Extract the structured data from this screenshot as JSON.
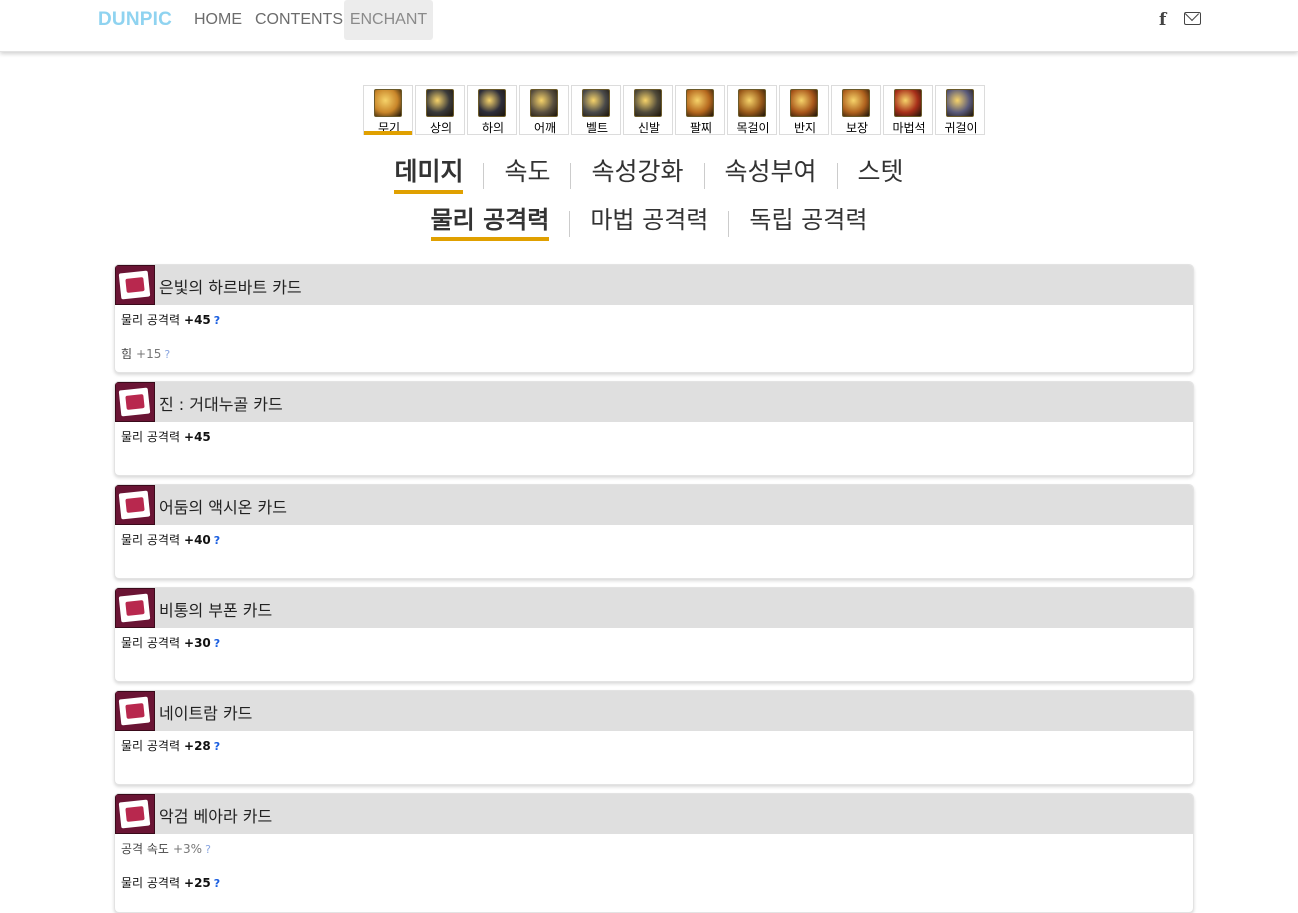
{
  "nav": {
    "brand": "DUNPIC",
    "links": [
      "HOME",
      "CONTENTS",
      "ENCHANT"
    ],
    "social": [
      {
        "icon": "facebook-icon",
        "glyph": "f"
      },
      {
        "icon": "mail-icon"
      }
    ]
  },
  "slots": [
    {
      "label": "무기",
      "color": "#c9862a"
    },
    {
      "label": "상의",
      "color": "#3a3a3a"
    },
    {
      "label": "하의",
      "color": "#2e2e3a"
    },
    {
      "label": "어깨",
      "color": "#5a5040"
    },
    {
      "label": "벨트",
      "color": "#4a4a4a"
    },
    {
      "label": "신발",
      "color": "#504a3a"
    },
    {
      "label": "팔찌",
      "color": "#b5681e"
    },
    {
      "label": "목걸이",
      "color": "#9a5a1a"
    },
    {
      "label": "반지",
      "color": "#a8561a"
    },
    {
      "label": "보장",
      "color": "#b0621e"
    },
    {
      "label": "마법석",
      "color": "#a8301a"
    },
    {
      "label": "귀걸이",
      "color": "#5a5a7a"
    }
  ],
  "categories": [
    "데미지",
    "속도",
    "속성강화",
    "속성부여",
    "스텟"
  ],
  "subcategories": [
    "물리 공격력",
    "마법 공격력",
    "독립 공격력"
  ],
  "cards": [
    {
      "name": "은빛의 하르바트 카드",
      "stats": [
        {
          "label": "물리 공격력",
          "value": "+45",
          "q": "?",
          "bold": true
        },
        {
          "label": "힘",
          "value": "+15",
          "q": "?",
          "bold": false
        }
      ]
    },
    {
      "name": "진 : 거대누골 카드",
      "stats": [
        {
          "label": "물리 공격력",
          "value": "+45",
          "q": "",
          "bold": true
        }
      ]
    },
    {
      "name": "어둠의 액시온 카드",
      "stats": [
        {
          "label": "물리 공격력",
          "value": "+40",
          "q": "?",
          "bold": true
        }
      ]
    },
    {
      "name": "비통의 부폰 카드",
      "stats": [
        {
          "label": "물리 공격력",
          "value": "+30",
          "q": "?",
          "bold": true
        }
      ]
    },
    {
      "name": "네이트람 카드",
      "stats": [
        {
          "label": "물리 공격력",
          "value": "+28",
          "q": "?",
          "bold": true
        }
      ]
    },
    {
      "name": "악검 베아라 카드",
      "stats": [
        {
          "label": "공격 속도",
          "value": "+3%",
          "q": "?",
          "bold": false
        },
        {
          "label": "물리 공격력",
          "value": "+25",
          "q": "?",
          "bold": true
        }
      ]
    }
  ]
}
